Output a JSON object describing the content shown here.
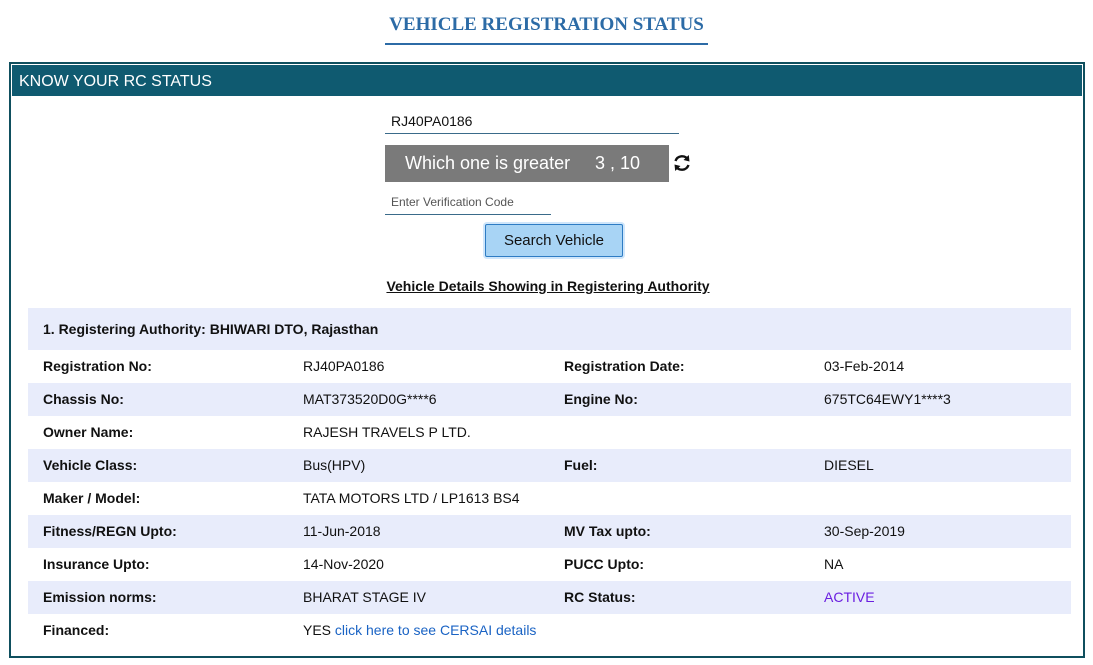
{
  "page_title": "VEHICLE REGISTRATION STATUS",
  "panel": {
    "header": "KNOW YOUR RC STATUS"
  },
  "search": {
    "registration_value": "RJ40PA0186",
    "captcha_question": "Which one is greater",
    "captcha_numbers": "3 , 10",
    "verification_placeholder": "Enter Verification Code",
    "search_button": "Search Vehicle",
    "refresh_icon": "refresh-icon"
  },
  "details": {
    "heading": "Vehicle Details Showing in Registering Authority",
    "authority": "1. Registering Authority: BHIWARI DTO, Rajasthan",
    "rows": [
      {
        "l1": "Registration No:",
        "v1": "RJ40PA0186",
        "l2": "Registration Date:",
        "v2": "03-Feb-2014"
      },
      {
        "l1": "Chassis No:",
        "v1": "MAT373520D0G****6",
        "l2": "Engine No:",
        "v2": "675TC64EWY1****3"
      },
      {
        "l1": "Owner Name:",
        "v1": "RAJESH TRAVELS P LTD.",
        "l2": "",
        "v2": ""
      },
      {
        "l1": "Vehicle Class:",
        "v1": "Bus(HPV)",
        "l2": "Fuel:",
        "v2": "DIESEL"
      },
      {
        "l1": "Maker / Model:",
        "v1": "TATA MOTORS LTD / LP1613 BS4",
        "l2": "",
        "v2": ""
      },
      {
        "l1": "Fitness/REGN Upto:",
        "v1": "11-Jun-2018",
        "l2": "MV Tax upto:",
        "v2": "30-Sep-2019"
      },
      {
        "l1": "Insurance Upto:",
        "v1": "14-Nov-2020",
        "l2": "PUCC Upto:",
        "v2": "NA"
      },
      {
        "l1": "Emission norms:",
        "v1": "BHARAT STAGE IV",
        "l2": "RC Status:",
        "v2": "ACTIVE"
      }
    ],
    "financed": {
      "label": "Financed:",
      "value": "YES",
      "link": "click here to see CERSAI details"
    }
  },
  "colors": {
    "title": "#2c6ba6",
    "header_bg": "#0f5a70",
    "row_shade": "#e8ecfb",
    "active_status": "#6a1ee0",
    "link": "#1a63c4"
  }
}
